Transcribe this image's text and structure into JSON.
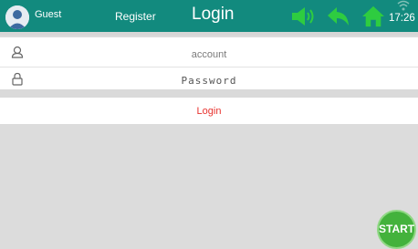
{
  "header": {
    "user_label": "Guest",
    "register_label": "Register",
    "title": "Login",
    "time": "17:26",
    "icons": [
      "avatar",
      "volume-icon",
      "back-icon",
      "home-icon",
      "wifi-icon"
    ]
  },
  "form": {
    "account_placeholder": "account",
    "password_placeholder": "Password",
    "login_label": "Login"
  },
  "start_label": "START",
  "colors": {
    "topbar": "#128a7e",
    "icon_green": "#2ecc40",
    "login_text": "#e8322e",
    "start_button": "#43b23c"
  }
}
